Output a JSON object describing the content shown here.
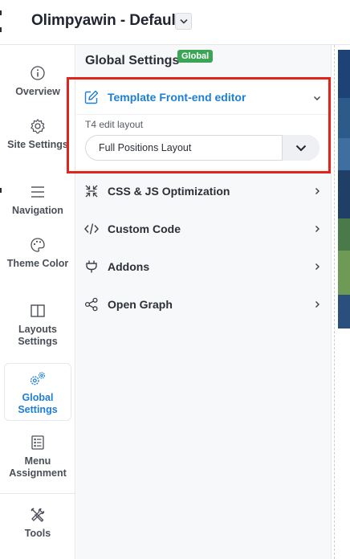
{
  "header": {
    "title": "Olimpyawin - Default",
    "dropdown_icon": "chevron-down-icon"
  },
  "sidebar": {
    "items": [
      {
        "label": "Overview",
        "icon": "info-icon",
        "active": false
      },
      {
        "label": "Site Settings",
        "icon": "gear-icon",
        "active": false
      },
      {
        "label": "Navigation",
        "icon": "menu-lines-icon",
        "active": false
      },
      {
        "label": "Theme Color",
        "icon": "palette-icon",
        "active": false
      },
      {
        "label": "Layouts Settings",
        "icon": "layout-columns-icon",
        "active": false
      },
      {
        "label": "Global Settings",
        "icon": "gears-icon",
        "active": true
      },
      {
        "label": "Menu Assignment",
        "icon": "checklist-icon",
        "active": false
      },
      {
        "label": "Tools",
        "icon": "wrench-screwdriver-icon",
        "active": false
      }
    ]
  },
  "panel": {
    "title": "Global Settings",
    "badge": "Global",
    "open_section": {
      "label": "Template Front-end editor",
      "icon": "edit-icon",
      "field_label": "T4 edit layout",
      "select_value": "Full Positions Layout"
    },
    "sections": [
      {
        "label": "CSS & JS Optimization",
        "icon": "compress-icon"
      },
      {
        "label": "Custom Code",
        "icon": "code-icon"
      },
      {
        "label": "Addons",
        "icon": "plug-icon"
      },
      {
        "label": "Open Graph",
        "icon": "share-icon"
      }
    ]
  },
  "colors": {
    "accent": "#1c7ed6",
    "badge": "#3aa655",
    "highlight": "#e0261c"
  }
}
